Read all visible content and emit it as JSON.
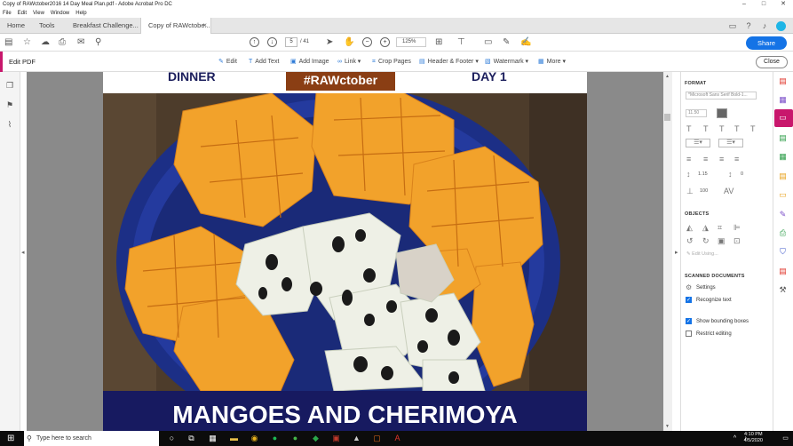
{
  "window": {
    "title": "Copy of RAWctober2016 14 Day Meal Plan.pdf - Adobe Acrobat Pro DC",
    "controls": [
      "–",
      "□",
      "✕"
    ]
  },
  "menubar": [
    "File",
    "Edit",
    "View",
    "Window",
    "Help"
  ],
  "tabs": {
    "home": "Home",
    "tools": "Tools",
    "doc1": "Breakfast Challenge...",
    "doc2": "Copy of RAWctobe...",
    "close": "×"
  },
  "toolbar": {
    "page_current": "5",
    "page_total": "/ 41",
    "zoom": "125%",
    "share_label": "Share"
  },
  "editbar": {
    "label": "Edit PDF",
    "tools": [
      "Edit",
      "Add Text",
      "Add Image",
      "Link ▾",
      "Crop Pages",
      "Header & Footer ▾",
      "Watermark ▾",
      "More ▾"
    ],
    "close_label": "Close"
  },
  "document": {
    "heading_left": "DINNER",
    "heading_center": "#RAWctober",
    "heading_right": "DAY 1",
    "banner": "MANGOES AND CHERIMOYA"
  },
  "panel": {
    "format_title": "FORMAT",
    "font_select": "*Microsoft Sans Serif Bold-1...",
    "font_size": "11.50",
    "line_spacing": "1.15",
    "para_spacing": "0",
    "scale": "100",
    "objects_title": "OBJECTS",
    "edit_using": "Edit Using...",
    "scanned_title": "SCANNED DOCUMENTS",
    "settings_label": "Settings",
    "recognize_label": "Recognize text",
    "recognize_checked": true,
    "bounding_label": "Show bounding boxes",
    "bounding_checked": true,
    "restrict_label": "Restrict editing",
    "restrict_checked": false
  },
  "taskbar": {
    "search_placeholder": "Type here to search",
    "time": "4:10 PM",
    "date": "4/5/2020"
  },
  "colors": {
    "accent_blue": "#1473e6",
    "edit_magenta": "#c8176c",
    "banner_navy": "#171a60",
    "hashtag_brown": "#8a3e14"
  }
}
